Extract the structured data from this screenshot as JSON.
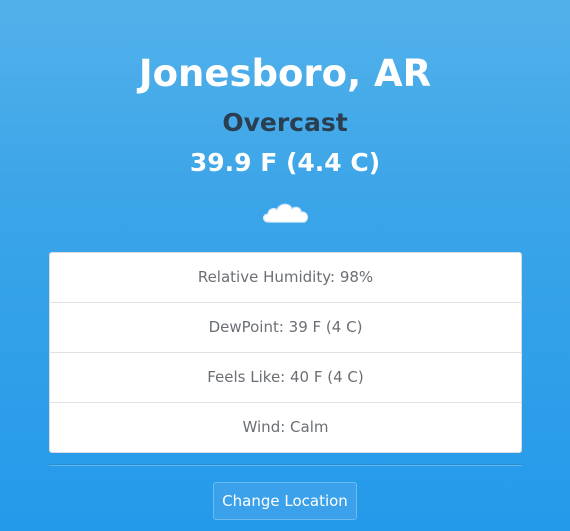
{
  "location": {
    "name": "Jonesboro, AR"
  },
  "current": {
    "condition": "Overcast",
    "temperature": "39.9 F (4.4 C)",
    "icon": "cloud-icon"
  },
  "details": [
    {
      "label": "Relative Humidity: 98%"
    },
    {
      "label": "DewPoint: 39 F (4 C)"
    },
    {
      "label": "Feels Like: 40 F (4 C)"
    },
    {
      "label": "Wind: Calm"
    }
  ],
  "actions": {
    "change_location_label": "Change Location"
  },
  "colors": {
    "background_top": "#52b1ea",
    "background_bottom": "#249aea",
    "condition_text": "#2b3e50",
    "detail_text": "#6b6f74"
  }
}
